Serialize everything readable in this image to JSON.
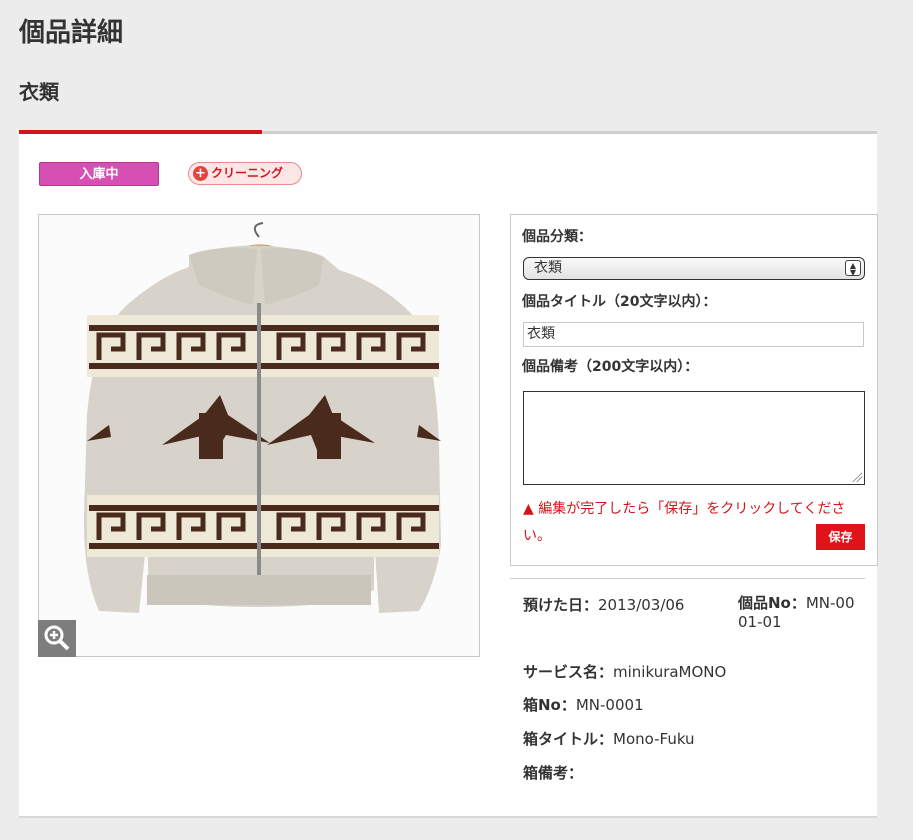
{
  "page": {
    "title": "個品詳細",
    "category": "衣類"
  },
  "status": {
    "badge": "入庫中",
    "cleaning_label": "クリーニング",
    "cleaning_icon": "plus-circle-icon"
  },
  "photo": {
    "alt": "カウチンセーター",
    "zoom_icon": "zoom-in-icon"
  },
  "form": {
    "category_label": "個品分類：",
    "category_value": "衣類",
    "title_label": "個品タイトル（20文字以内）：",
    "title_value": "衣類",
    "note_label": "個品備考（200文字以内）：",
    "note_value": "",
    "notice": "▲ 編集が完了したら「保存」をクリックしてください。",
    "save_label": "保存"
  },
  "info": {
    "deposit_date_label": "預けた日：",
    "deposit_date": "2013/03/06",
    "item_no_label": "個品No：",
    "item_no": "MN-0001-01",
    "service_label": "サービス名：",
    "service": "minikuraMONO",
    "box_no_label": "箱No：",
    "box_no": "MN-0001",
    "box_title_label": "箱タイトル：",
    "box_title": "Mono-Fuku",
    "box_note_label": "箱備考：",
    "box_note": ""
  },
  "colors": {
    "accent": "#d2151b",
    "status_badge": "#d84fb3"
  }
}
